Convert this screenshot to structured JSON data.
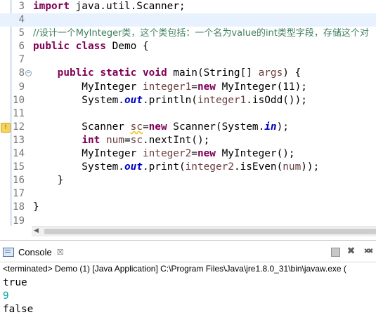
{
  "editor": {
    "lines": [
      {
        "number": "3",
        "tokens": [
          {
            "t": "import",
            "c": "kw"
          },
          {
            "t": " java.util.Scanner;",
            "c": ""
          }
        ]
      },
      {
        "number": "4",
        "current": true,
        "tokens": []
      },
      {
        "number": "5",
        "tokens": [
          {
            "t": "//设计一个MyInteger类，这个类包括：一个名为value的int类型字段，存储这个对",
            "c": "cmt"
          }
        ]
      },
      {
        "number": "6",
        "tokens": [
          {
            "t": "public",
            "c": "kw"
          },
          {
            "t": " ",
            "c": ""
          },
          {
            "t": "class",
            "c": "kw"
          },
          {
            "t": " Demo {",
            "c": ""
          }
        ]
      },
      {
        "number": "7",
        "tokens": []
      },
      {
        "number": "8",
        "fold": "minus",
        "tokens": [
          {
            "t": "    ",
            "c": ""
          },
          {
            "t": "public",
            "c": "kw"
          },
          {
            "t": " ",
            "c": ""
          },
          {
            "t": "static",
            "c": "kw"
          },
          {
            "t": " ",
            "c": ""
          },
          {
            "t": "void",
            "c": "kw"
          },
          {
            "t": " main(String[] ",
            "c": ""
          },
          {
            "t": "args",
            "c": "var"
          },
          {
            "t": ") {",
            "c": ""
          }
        ]
      },
      {
        "number": "9",
        "tokens": [
          {
            "t": "        MyInteger ",
            "c": ""
          },
          {
            "t": "integer1",
            "c": "var"
          },
          {
            "t": "=",
            "c": ""
          },
          {
            "t": "new",
            "c": "kw"
          },
          {
            "t": " MyInteger(11);",
            "c": ""
          }
        ]
      },
      {
        "number": "10",
        "tokens": [
          {
            "t": "        System.",
            "c": ""
          },
          {
            "t": "out",
            "c": "fld"
          },
          {
            "t": ".println(",
            "c": ""
          },
          {
            "t": "integer1",
            "c": "var"
          },
          {
            "t": ".isOdd());",
            "c": ""
          }
        ]
      },
      {
        "number": "11",
        "tokens": []
      },
      {
        "number": "12",
        "warning": true,
        "tokens": [
          {
            "t": "        Scanner ",
            "c": ""
          },
          {
            "t": "sc",
            "c": "warn-var"
          },
          {
            "t": "=",
            "c": ""
          },
          {
            "t": "new",
            "c": "kw"
          },
          {
            "t": " Scanner(System.",
            "c": ""
          },
          {
            "t": "in",
            "c": "fld"
          },
          {
            "t": ");",
            "c": ""
          }
        ]
      },
      {
        "number": "13",
        "tokens": [
          {
            "t": "        ",
            "c": ""
          },
          {
            "t": "int",
            "c": "kw"
          },
          {
            "t": " ",
            "c": ""
          },
          {
            "t": "num",
            "c": "var"
          },
          {
            "t": "=",
            "c": ""
          },
          {
            "t": "sc",
            "c": "var"
          },
          {
            "t": ".nextInt();",
            "c": ""
          }
        ]
      },
      {
        "number": "14",
        "tokens": [
          {
            "t": "        MyInteger ",
            "c": ""
          },
          {
            "t": "integer2",
            "c": "var"
          },
          {
            "t": "=",
            "c": ""
          },
          {
            "t": "new",
            "c": "kw"
          },
          {
            "t": " MyInteger();",
            "c": ""
          }
        ]
      },
      {
        "number": "15",
        "tokens": [
          {
            "t": "        System.",
            "c": ""
          },
          {
            "t": "out",
            "c": "fld"
          },
          {
            "t": ".print(",
            "c": ""
          },
          {
            "t": "integer2",
            "c": "var"
          },
          {
            "t": ".isEven(",
            "c": ""
          },
          {
            "t": "num",
            "c": "var"
          },
          {
            "t": "));",
            "c": ""
          }
        ]
      },
      {
        "number": "16",
        "tokens": [
          {
            "t": "    }",
            "c": ""
          }
        ]
      },
      {
        "number": "17",
        "tokens": []
      },
      {
        "number": "18",
        "tokens": [
          {
            "t": "}",
            "c": ""
          }
        ]
      },
      {
        "number": "19",
        "tokens": []
      }
    ],
    "scroll_left_icon": "chevron-left-icon"
  },
  "console": {
    "tab_label": "Console",
    "tab_close_symbol": "☒",
    "toolbar": [
      {
        "name": "terminate-icon"
      },
      {
        "name": "remove-launch-icon",
        "symbol": "✖"
      },
      {
        "name": "remove-all-terminated-icon",
        "symbol": "✖✖"
      }
    ],
    "status": "<terminated> Demo (1) [Java Application] C:\\Program Files\\Java\\jre1.8.0_31\\bin\\javaw.exe (",
    "output": [
      {
        "text": "true",
        "stream": "stdout"
      },
      {
        "text": "9",
        "stream": "stdin"
      },
      {
        "text": "false",
        "stream": "stdout"
      }
    ]
  },
  "colors": {
    "keyword": "#7f0055",
    "comment": "#3f7f5f",
    "field": "#0000c0",
    "local_variable": "#6a3e3e",
    "stdin": "#00a0a0",
    "current_line": "#e8f2fe"
  }
}
